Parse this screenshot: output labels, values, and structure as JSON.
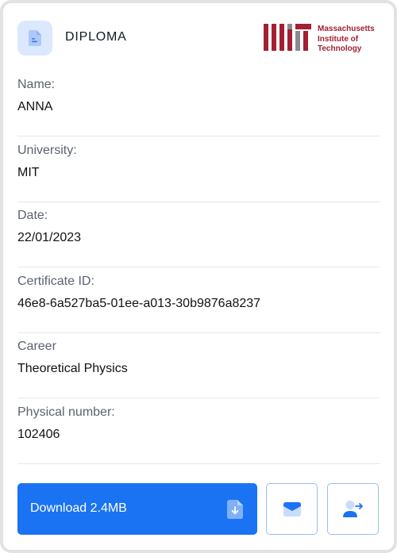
{
  "header": {
    "title": "DIPLOMA",
    "icon": "document-icon",
    "logo": {
      "name": "mit-logo",
      "lines": [
        "Massachusetts",
        "Institute of",
        "Technology"
      ],
      "color": "#a31f34"
    }
  },
  "fields": [
    {
      "label": "Name:",
      "value": "ANNA"
    },
    {
      "label": "University:",
      "value": "MIT"
    },
    {
      "label": "Date:",
      "value": "22/01/2023"
    },
    {
      "label": "Certificate ID:",
      "value": "46e8-6a527ba5-01ee-a013-30b9876a8237"
    },
    {
      "label": "Career",
      "value": "Theoretical Physics"
    },
    {
      "label": "Physical number:",
      "value": "102406"
    }
  ],
  "actions": {
    "download_label": "Download 2.4MB",
    "download_icon": "download-file-icon",
    "email_icon": "envelope-icon",
    "transfer_icon": "user-transfer-icon",
    "accent_color": "#1a73f2"
  }
}
